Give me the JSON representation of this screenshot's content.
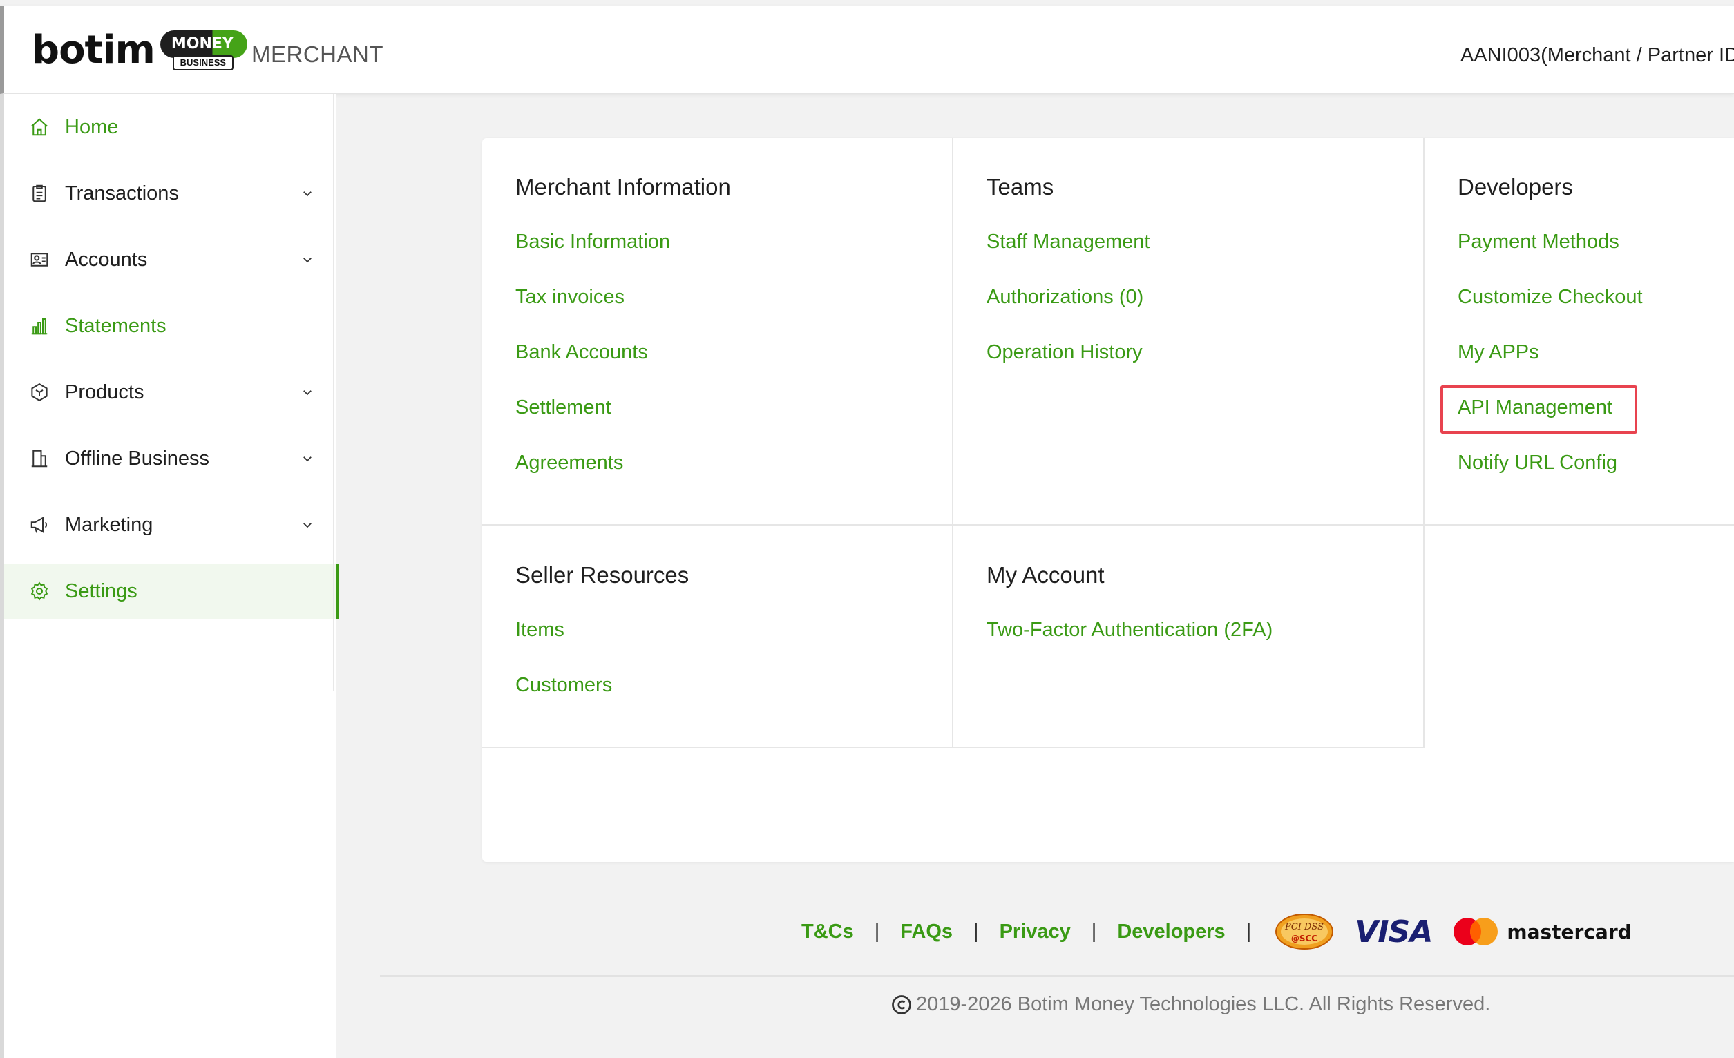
{
  "header": {
    "logo_word": "botim",
    "logo_badge": "MONEY",
    "logo_sub": "BUSINESS",
    "portal_label": "MERCHANT",
    "partner_id": "AANI003(Merchant / Partner ID"
  },
  "sidebar": {
    "items": [
      {
        "label": "Home",
        "icon": "home-icon",
        "expandable": false
      },
      {
        "label": "Transactions",
        "icon": "clipboard-icon",
        "expandable": true
      },
      {
        "label": "Accounts",
        "icon": "id-card-icon",
        "expandable": true
      },
      {
        "label": "Statements",
        "icon": "bar-chart-icon",
        "expandable": false
      },
      {
        "label": "Products",
        "icon": "box-icon",
        "expandable": true
      },
      {
        "label": "Offline Business",
        "icon": "building-icon",
        "expandable": true
      },
      {
        "label": "Marketing",
        "icon": "megaphone-icon",
        "expandable": true
      },
      {
        "label": "Settings",
        "icon": "gear-icon",
        "expandable": false,
        "active": true
      }
    ]
  },
  "sections": {
    "merchant_information": {
      "title": "Merchant Information",
      "links": [
        "Basic Information",
        "Tax invoices",
        "Bank Accounts",
        "Settlement",
        "Agreements"
      ]
    },
    "teams": {
      "title": "Teams",
      "links": [
        "Staff Management",
        "Authorizations (0)",
        "Operation History"
      ]
    },
    "developers": {
      "title": "Developers",
      "links": [
        "Payment Methods",
        "Customize Checkout",
        "My APPs",
        "API Management",
        "Notify URL Config"
      ]
    },
    "seller_resources": {
      "title": "Seller Resources",
      "links": [
        "Items",
        "Customers"
      ]
    },
    "my_account": {
      "title": "My Account",
      "links": [
        "Two-Factor Authentication (2FA)"
      ]
    }
  },
  "footer": {
    "links": [
      "T&Cs",
      "FAQs",
      "Privacy",
      "Developers"
    ],
    "separator": "|",
    "pci_text": "PCI DSS",
    "pci_sub": "@SCC",
    "visa": "VISA",
    "mastercard": "mastercard",
    "copyright": "2019-2026 Botim Money Technologies LLC. All Rights Reserved."
  },
  "colors": {
    "accent": "#3a9a14",
    "highlight": "#e8434f",
    "visa": "#1a1f71",
    "mc_red": "#eb001b",
    "mc_orange": "#f79e1b"
  }
}
